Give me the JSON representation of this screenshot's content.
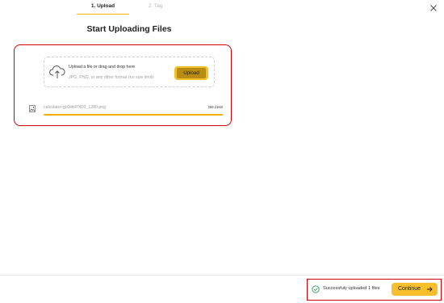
{
  "steps": [
    {
      "label": "1. Upload"
    },
    {
      "label": "2. Tag"
    }
  ],
  "title": "Start Uploading Files",
  "dropzone": {
    "primary_text": "Upload a file or drag and drop here",
    "secondary_text": "JPG, PNG, or any other format (no size limit)",
    "button_label": "Upload"
  },
  "files": [
    {
      "name": "calculator-gc0eb47403_1280.png",
      "size": "259.21KB",
      "progress": 1.0
    }
  ],
  "footer": {
    "status_text": "Successfuly uploaded 1 files",
    "continue_label": "Continue"
  },
  "colors": {
    "accent": "#f2b300",
    "highlight_outline": "#d40000",
    "success": "#2e9d58"
  },
  "icons": [
    "close-icon",
    "cloud-upload-icon",
    "image-file-icon",
    "check-circle-icon",
    "arrow-right-icon"
  ]
}
